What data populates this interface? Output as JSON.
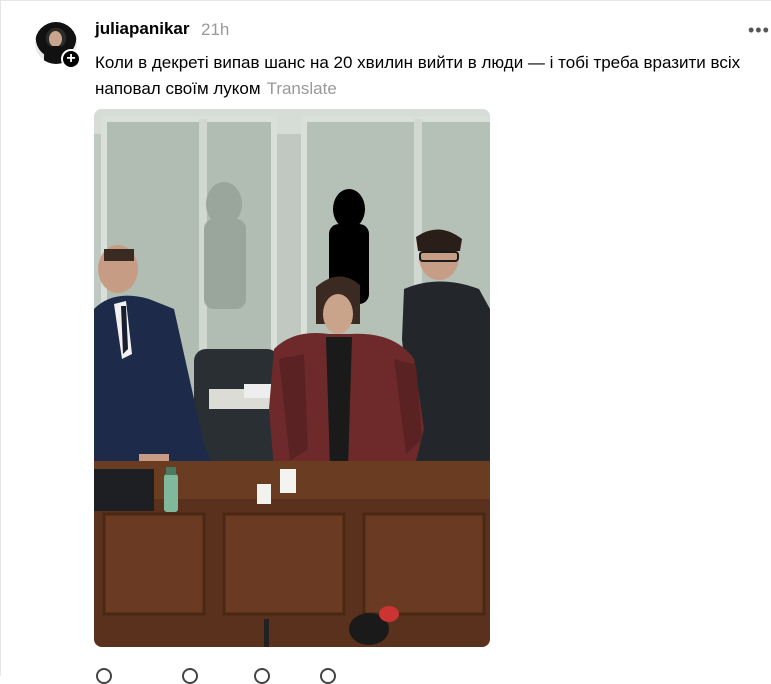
{
  "post": {
    "username": "juliapanikar",
    "time": "21h",
    "text": "Коли в декреті випав шанс на 20 хвилин вийти в люди — і тобі треба вразити всіх наповал своїм луком",
    "translate_label": "Translate",
    "follow_icon": "plus-icon",
    "more_icon": "more-icon"
  },
  "actions": [
    "heart-icon",
    "comment-icon",
    "repost-icon",
    "share-icon"
  ]
}
